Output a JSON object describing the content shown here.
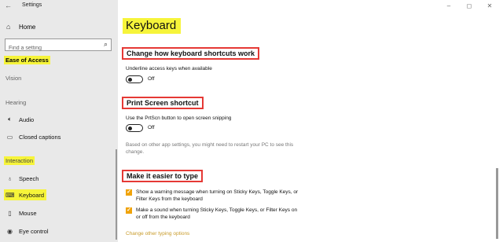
{
  "window": {
    "title": "Settings",
    "back_glyph": "←",
    "controls": [
      "–",
      "◻",
      "✕"
    ]
  },
  "sidebar": {
    "home_label": "Home",
    "search_placeholder": "Find a setting",
    "section_title": "Ease of Access",
    "categories": {
      "vision": "Vision",
      "hearing": "Hearing",
      "interaction": "Interaction"
    },
    "items": [
      {
        "label": "Audio",
        "icon": "speaker-icon"
      },
      {
        "label": "Closed captions",
        "icon": "captions-icon"
      },
      {
        "label": "Speech",
        "icon": "microphone-icon"
      },
      {
        "label": "Keyboard",
        "icon": "keyboard-icon",
        "selected": true
      },
      {
        "label": "Mouse",
        "icon": "mouse-icon"
      },
      {
        "label": "Eye control",
        "icon": "eye-icon"
      }
    ]
  },
  "main": {
    "title": "Keyboard",
    "sections": [
      {
        "heading": "Change how keyboard shortcuts work",
        "description": "Underline access keys when available",
        "toggle_state": "Off"
      },
      {
        "heading": "Print Screen shortcut",
        "description": "Use the PrtScn button to open screen snipping",
        "toggle_state": "Off",
        "note": "Based on other app settings, you might need to restart your PC to see this change."
      },
      {
        "heading": "Make it easier to type",
        "checkboxes": [
          {
            "label": "Show a warning message when turning on Sticky Keys, Toggle Keys, or Filter Keys from the keyboard",
            "checked": true
          },
          {
            "label": "Make a sound when turning Sticky Keys, Toggle Keys, or Filter Keys on or off from the keyboard",
            "checked": true
          }
        ],
        "link": "Change other typing options"
      }
    ]
  },
  "colors": {
    "highlight": "#f6f43a",
    "annotation_box": "#e53935",
    "checkbox_accent": "#f0a30a",
    "sidebar_bg": "#e9e9e9"
  }
}
